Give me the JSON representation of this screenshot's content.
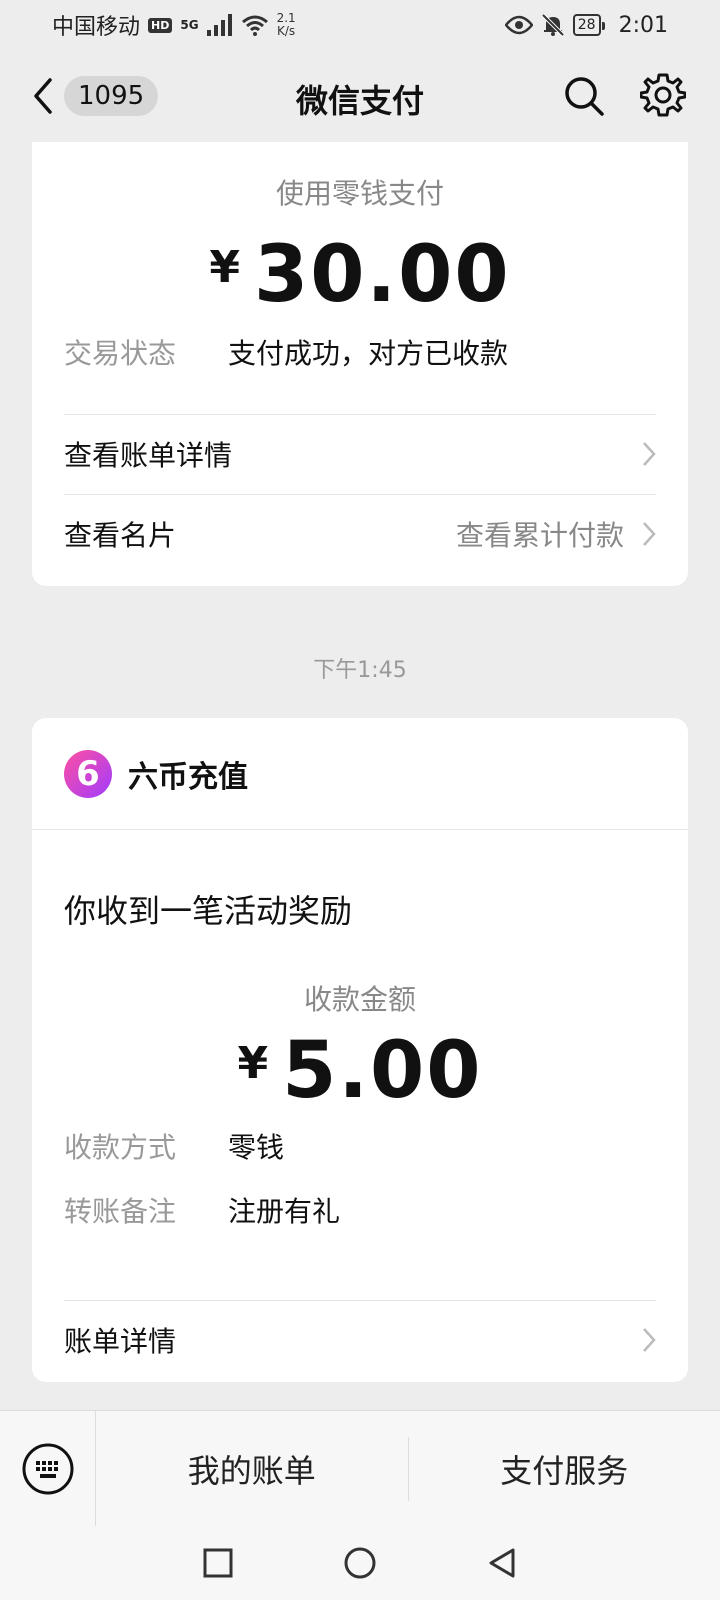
{
  "status_bar": {
    "carrier": "中国移动",
    "hd": "HD",
    "network": "5G",
    "speed_value": "2.1",
    "speed_unit": "K/s",
    "battery": "28",
    "time": "2:01"
  },
  "nav": {
    "unread_count": "1095",
    "title": "微信支付"
  },
  "payment_card": {
    "pay_label": "使用零钱支付",
    "currency": "¥",
    "amount": "30.00",
    "status_key": "交易状态",
    "status_value": "支付成功，对方已收款",
    "bill_detail": "查看账单详情",
    "business_card": "查看名片",
    "cumulative": "查看累计付款"
  },
  "timestamp": "下午1:45",
  "reward_card": {
    "brand_logo_char": "6",
    "brand_name": "六币充值",
    "notice": "你收到一笔活动奖励",
    "amount_label": "收款金额",
    "currency": "¥",
    "amount": "5.00",
    "method_key": "收款方式",
    "method_value": "零钱",
    "memo_key": "转账备注",
    "memo_value": "注册有礼",
    "bill_detail": "账单详情"
  },
  "bottom_bar": {
    "my_bills": "我的账单",
    "pay_services": "支付服务"
  },
  "icons": {
    "back": "chevron-left-icon",
    "search": "search-icon",
    "settings": "gear-icon",
    "keyboard": "keyboard-icon"
  }
}
